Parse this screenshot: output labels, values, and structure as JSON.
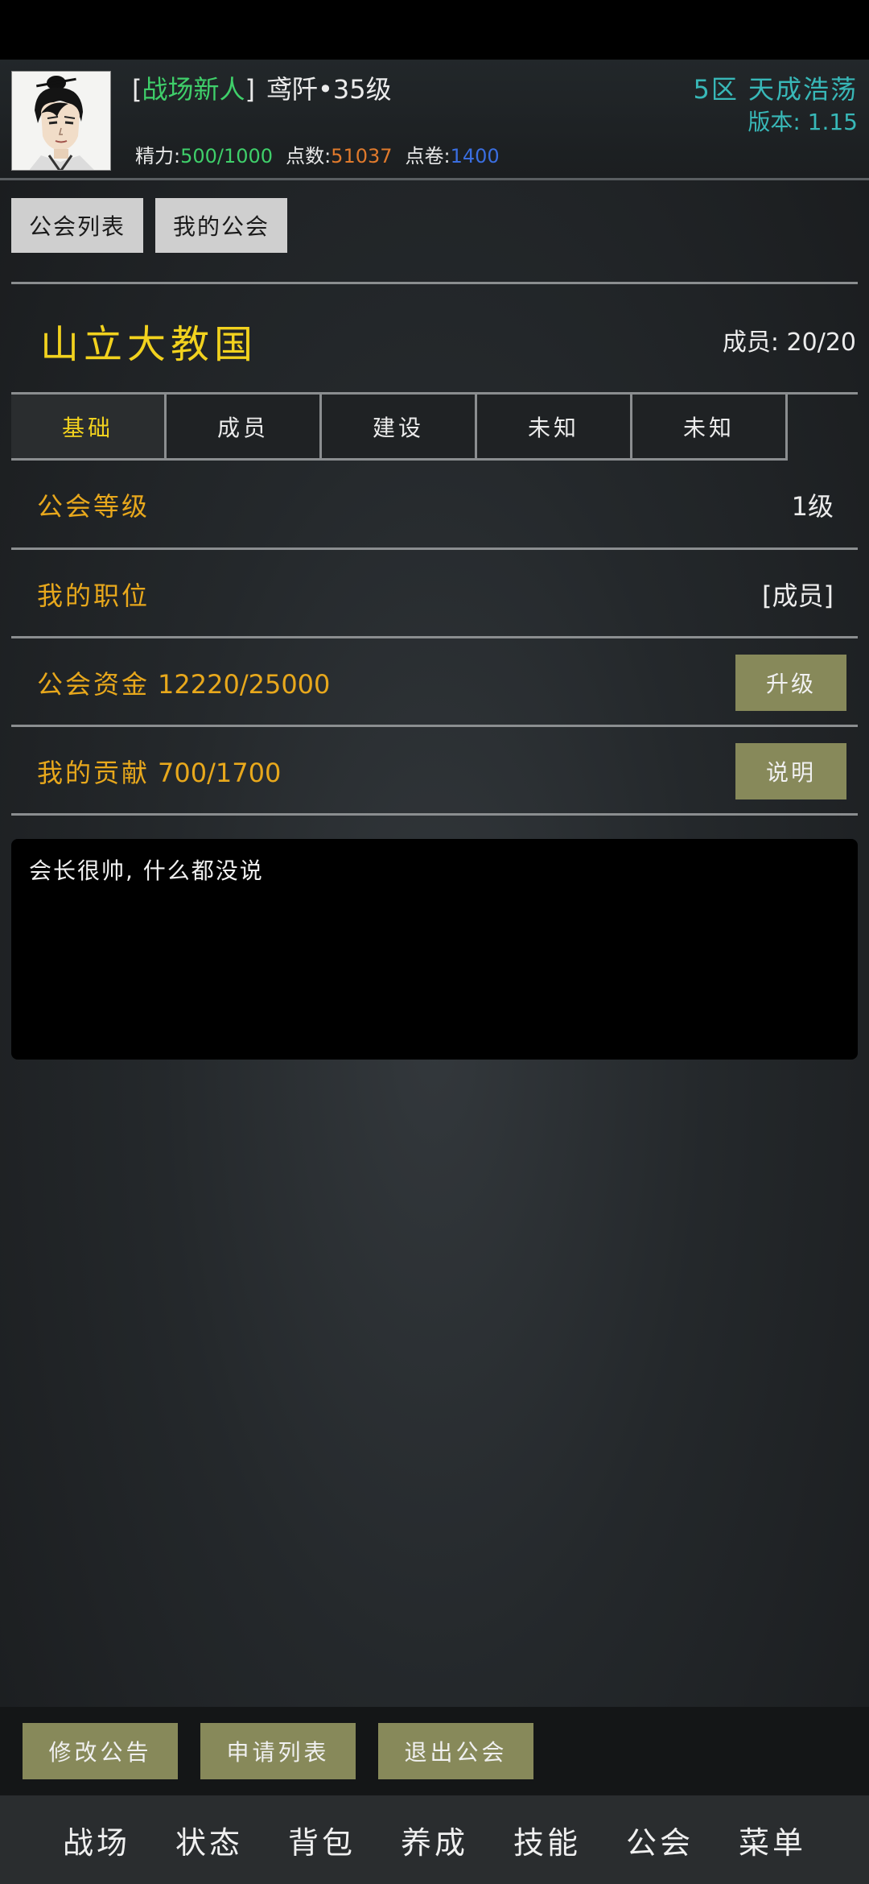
{
  "header": {
    "title_open": "[",
    "title_tag": "战场新人",
    "title_close": "]",
    "player_name": "鸢阡•35级",
    "server": "5区 天成浩荡",
    "version": "版本: 1.15",
    "energy_label": "精力:",
    "energy_value": "500/1000",
    "points_label": "点数:",
    "points_value": "51037",
    "vouchers_label": "点卷:",
    "vouchers_value": "1400",
    "avatar_icon": "avatar-portrait-icon"
  },
  "top_tabs": [
    "公会列表",
    "我的公会"
  ],
  "guild": {
    "name": "山立大教国",
    "members_label": "成员:",
    "members_value": "20/20"
  },
  "tabs": [
    "基础",
    "成员",
    "建设",
    "未知",
    "未知"
  ],
  "active_tab": 0,
  "rows": {
    "level_label": "公会等级",
    "level_value": "1级",
    "position_label": "我的职位",
    "position_value": "[成员]",
    "funds_label": "公会资金",
    "funds_value": "12220/25000",
    "upgrade_button": "升级",
    "contribution_label": "我的贡献",
    "contribution_value": "700/1700",
    "explain_button": "说明"
  },
  "notice": {
    "text": "会长很帅, 什么都没说"
  },
  "actions": [
    "修改公告",
    "申请列表",
    "退出公会"
  ],
  "nav": [
    "战场",
    "状态",
    "背包",
    "养成",
    "技能",
    "公会",
    "菜单"
  ],
  "colors": {
    "accent_gold": "#f2d21e",
    "label_orange": "#e8a81c",
    "button_olive": "#87895a",
    "green": "#3fcf6a",
    "teal": "#38b8b8"
  }
}
